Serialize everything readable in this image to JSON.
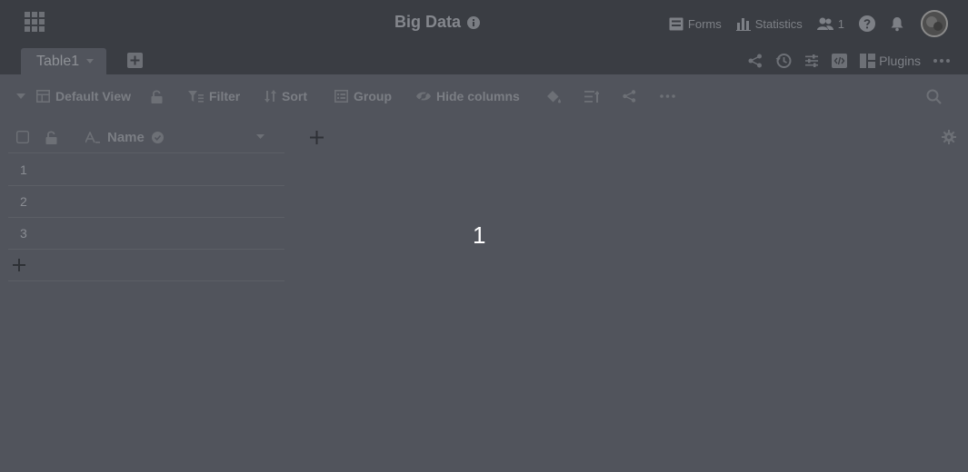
{
  "header": {
    "title": "Big Data",
    "forms_label": "Forms",
    "statistics_label": "Statistics",
    "collaborators_count": "1"
  },
  "tabs": {
    "active": "Table1"
  },
  "toolbar": {
    "plugins_label": "Plugins"
  },
  "view": {
    "name": "Default View",
    "filter_label": "Filter",
    "sort_label": "Sort",
    "group_label": "Group",
    "hide_columns_label": "Hide columns"
  },
  "grid": {
    "columns": [
      "Name"
    ],
    "rows": [
      "1",
      "2",
      "3"
    ]
  },
  "overlay": {
    "countdown": "1"
  },
  "colors": {
    "overlay_background": "#51545c",
    "header_background": "#3a3d43",
    "countdown_text": "#ffffff"
  }
}
